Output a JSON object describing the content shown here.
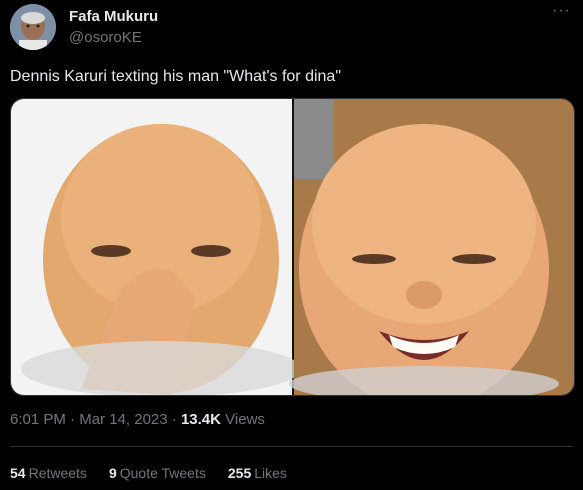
{
  "tweet": {
    "author_name": "Fafa Mukuru",
    "author_handle": "@osoroKE",
    "more_icon": "more-horizontal-icon",
    "text": "Dennis Karuri texting his man \"What's for dina\"",
    "time": "6:01 PM",
    "date": "Mar 14, 2023",
    "separator": "·",
    "views_count": "13.4K",
    "views_label": "Views",
    "retweets_count": "54",
    "retweets_label": "Retweets",
    "quotes_count": "9",
    "quotes_label": "Quote Tweets",
    "likes_count": "255",
    "likes_label": "Likes"
  },
  "colors": {
    "background": "#000000",
    "text": "#e7e9ea",
    "secondary": "#71767b",
    "border": "#2f3336"
  }
}
